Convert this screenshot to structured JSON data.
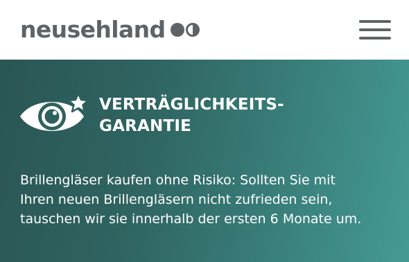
{
  "header": {
    "logo_text": "neusehland",
    "logo_mark": "eyes-logo-mark",
    "menu_icon": "hamburger-menu-icon"
  },
  "banner": {
    "icon": "eye-star-icon",
    "heading_lines": [
      "VERTRÄGLICHKEITS-",
      "GARANTIE"
    ],
    "text_lines": [
      "Brillengläser kaufen ohne Risiko: Sollten Sie mit",
      "Ihren neuen Brillengläsern nicht zufrieden sein,",
      "tauschen wir sie innerhalb der ersten 6 Monate um."
    ]
  },
  "colors": {
    "header_bg": "#ffffff",
    "logo_gray": "#5f6366",
    "banner_gradient_start": "#2a5654",
    "banner_gradient_end": "#459a95",
    "text": "#ffffff"
  }
}
